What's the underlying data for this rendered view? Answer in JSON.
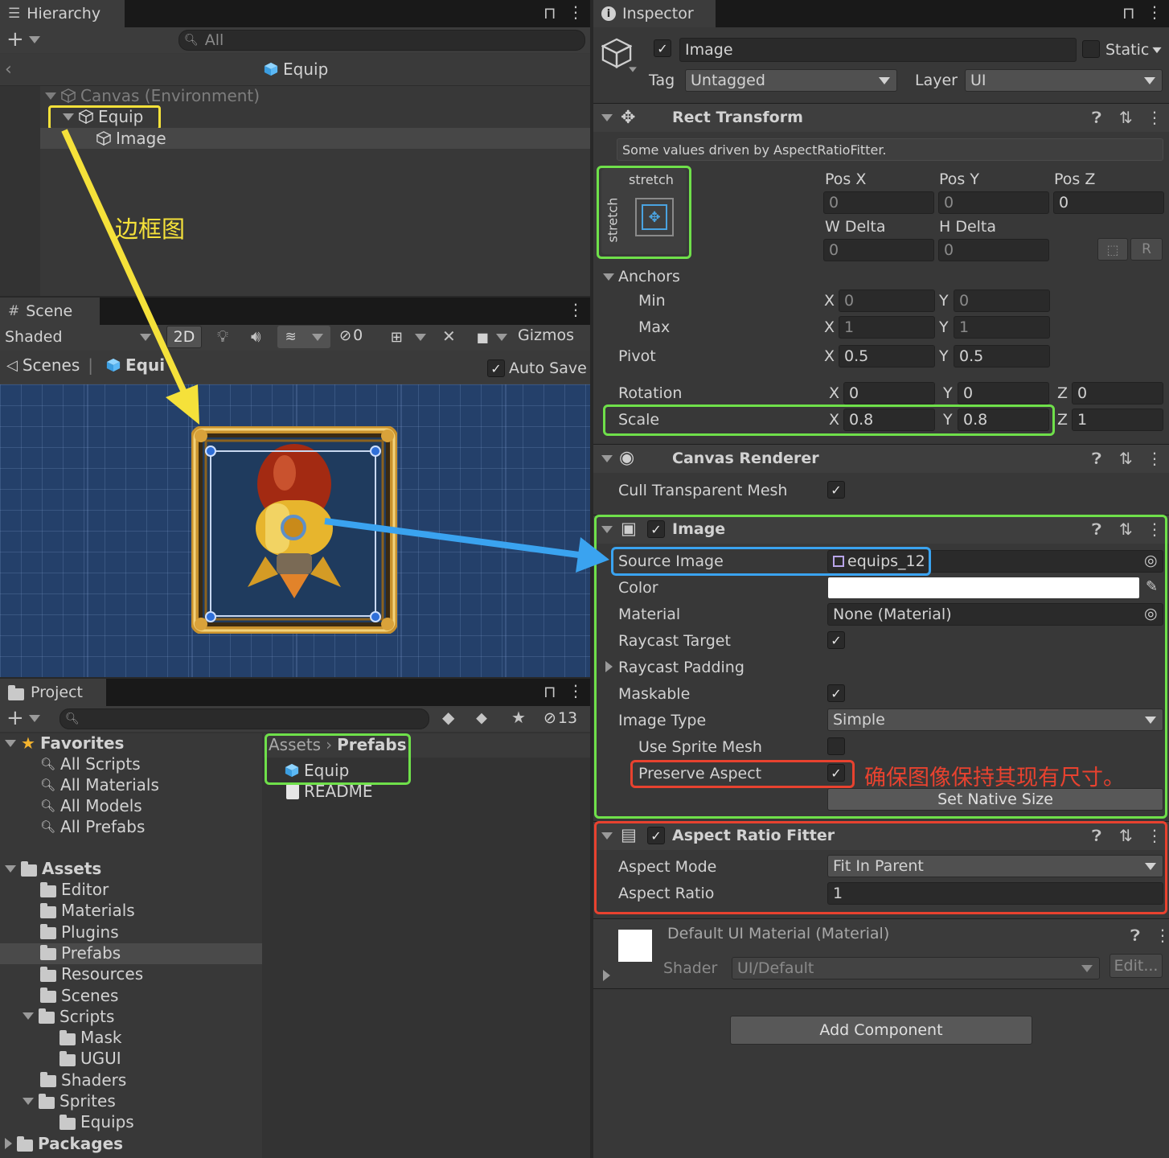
{
  "hierarchy": {
    "tab_label": "Hierarchy",
    "search_placeholder": "All",
    "prefab_title": "Equip",
    "items": [
      {
        "label": "Canvas (Environment)"
      },
      {
        "label": "Equip"
      },
      {
        "label": "Image"
      }
    ]
  },
  "annotation_frame": "边框图",
  "annotation_preserve": "确保图像保持其现有尺寸。",
  "scene": {
    "tab_label": "Scene",
    "shading_mode": "Shaded",
    "mode_2d": "2D",
    "hidden_count": "0",
    "gizmos_label": "Gizmos",
    "breadcrumb_scenes": "Scenes",
    "breadcrumb_prefab": "Equi",
    "auto_save_label": "Auto Save"
  },
  "project": {
    "tab_label": "Project",
    "hidden_count": "13",
    "favorites_label": "Favorites",
    "favorites": [
      "All Scripts",
      "All Materials",
      "All Models",
      "All Prefabs"
    ],
    "assets_label": "Assets",
    "folders": [
      {
        "label": "Editor",
        "indent": 1
      },
      {
        "label": "Materials",
        "indent": 1
      },
      {
        "label": "Plugins",
        "indent": 1
      },
      {
        "label": "Prefabs",
        "indent": 1
      },
      {
        "label": "Resources",
        "indent": 1
      },
      {
        "label": "Scenes",
        "indent": 1
      },
      {
        "label": "Scripts",
        "indent": 1
      },
      {
        "label": "Mask",
        "indent": 2
      },
      {
        "label": "UGUI",
        "indent": 2
      },
      {
        "label": "Shaders",
        "indent": 1
      },
      {
        "label": "Sprites",
        "indent": 1
      },
      {
        "label": "Equips",
        "indent": 2
      }
    ],
    "packages_label": "Packages",
    "breadcrumb_root": "Assets",
    "breadcrumb_current": "Prefabs",
    "files": [
      "Equip",
      "README"
    ]
  },
  "inspector": {
    "tab_label": "Inspector",
    "object_name": "Image",
    "static_label": "Static",
    "tag_label": "Tag",
    "tag_value": "Untagged",
    "layer_label": "Layer",
    "layer_value": "UI",
    "rect_transform": {
      "title": "Rect Transform",
      "driven_note": "Some values driven by AspectRatioFitter.",
      "anchor_preset_h": "stretch",
      "anchor_preset_v": "stretch",
      "pos_x_label": "Pos X",
      "pos_x": "0",
      "pos_y_label": "Pos Y",
      "pos_y": "0",
      "pos_z_label": "Pos Z",
      "pos_z": "0",
      "w_delta_label": "W Delta",
      "w_delta": "0",
      "h_delta_label": "H Delta",
      "h_delta": "0",
      "r_button": "R",
      "anchors_label": "Anchors",
      "min_label": "Min",
      "min_x": "0",
      "min_y": "0",
      "max_label": "Max",
      "max_x": "1",
      "max_y": "1",
      "pivot_label": "Pivot",
      "pivot_x": "0.5",
      "pivot_y": "0.5",
      "rotation_label": "Rotation",
      "rot_x": "0",
      "rot_y": "0",
      "rot_z": "0",
      "scale_label": "Scale",
      "scale_x": "0.8",
      "scale_y": "0.8",
      "scale_z": "1",
      "axis_x": "X",
      "axis_y": "Y",
      "axis_z": "Z"
    },
    "canvas_renderer": {
      "title": "Canvas Renderer",
      "cull_label": "Cull Transparent Mesh"
    },
    "image": {
      "title": "Image",
      "source_image_label": "Source Image",
      "source_image_value": "equips_12",
      "color_label": "Color",
      "color_value": "#ffffff",
      "material_label": "Material",
      "material_value": "None (Material)",
      "raycast_target_label": "Raycast Target",
      "raycast_padding_label": "Raycast Padding",
      "maskable_label": "Maskable",
      "image_type_label": "Image Type",
      "image_type_value": "Simple",
      "use_sprite_mesh_label": "Use Sprite Mesh",
      "preserve_aspect_label": "Preserve Aspect",
      "set_native_size": "Set Native Size"
    },
    "aspect_ratio_fitter": {
      "title": "Aspect Ratio Fitter",
      "aspect_mode_label": "Aspect Mode",
      "aspect_mode_value": "Fit In Parent",
      "aspect_ratio_label": "Aspect Ratio",
      "aspect_ratio_value": "1"
    },
    "material_section": {
      "title": "Default UI Material (Material)",
      "shader_label": "Shader",
      "shader_value": "UI/Default",
      "edit_button": "Edit..."
    },
    "add_component": "Add Component"
  },
  "colors": {
    "highlight_yellow": "#f5e13a",
    "highlight_green": "#6fe04a",
    "highlight_red": "#e8422f",
    "highlight_blue": "#3aa3f0",
    "scene_background": "#24406a",
    "prefab_cube": "#5bb8f5"
  }
}
